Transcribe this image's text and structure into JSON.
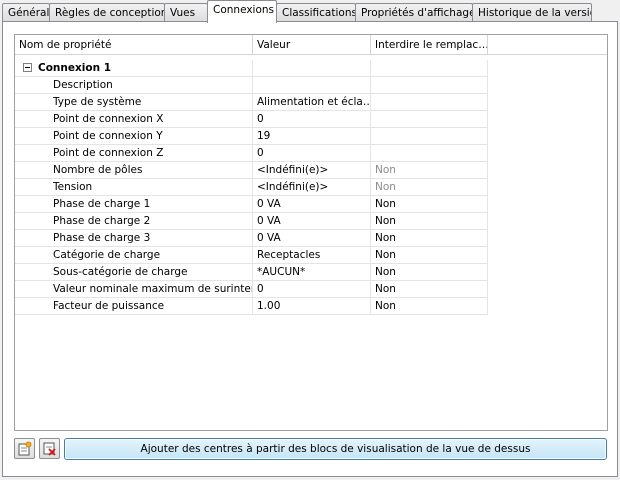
{
  "tabs": [
    {
      "label": "Général"
    },
    {
      "label": "Règles de conception"
    },
    {
      "label": "Vues"
    },
    {
      "label": "Connexions"
    },
    {
      "label": "Classifications"
    },
    {
      "label": "Propriétés d'affichage"
    },
    {
      "label": "Historique de la version"
    }
  ],
  "active_tab": "Connexions",
  "grid": {
    "headers": [
      "Nom de propriété",
      "Valeur",
      "Interdire le remplac…"
    ],
    "group_label": "Connexion 1",
    "rows": [
      {
        "name": "Description",
        "value": "",
        "override": ""
      },
      {
        "name": "Type de système",
        "value": "Alimentation et écla…",
        "override": ""
      },
      {
        "name": "Point de connexion X",
        "value": "0",
        "override": ""
      },
      {
        "name": "Point de connexion Y",
        "value": "19",
        "override": ""
      },
      {
        "name": "Point de connexion Z",
        "value": "0",
        "override": ""
      },
      {
        "name": "Nombre de pôles",
        "value": "<Indéfini(e)>",
        "override": "Non"
      },
      {
        "name": "Tension",
        "value": "<Indéfini(e)>",
        "override": "Non"
      },
      {
        "name": "Phase de charge 1",
        "value": "0 VA",
        "override": "Non"
      },
      {
        "name": "Phase de charge 2",
        "value": "0 VA",
        "override": "Non"
      },
      {
        "name": "Phase de charge 3",
        "value": "0 VA",
        "override": "Non"
      },
      {
        "name": "Catégorie de charge",
        "value": "Receptacles",
        "override": "Non"
      },
      {
        "name": "Sous-catégorie de charge",
        "value": "*AUCUN*",
        "override": "Non"
      },
      {
        "name": "Valeur nominale maximum de surintens…",
        "value": "0",
        "override": "Non"
      },
      {
        "name": "Facteur de puissance",
        "value": "1.00",
        "override": "Non"
      }
    ]
  },
  "toolbar": {
    "add_icon": "add-connection-icon",
    "delete_icon": "delete-connection-icon",
    "wide_button_label": "Ajouter des centres à partir des blocs de visualisation de la vue de dessus"
  }
}
